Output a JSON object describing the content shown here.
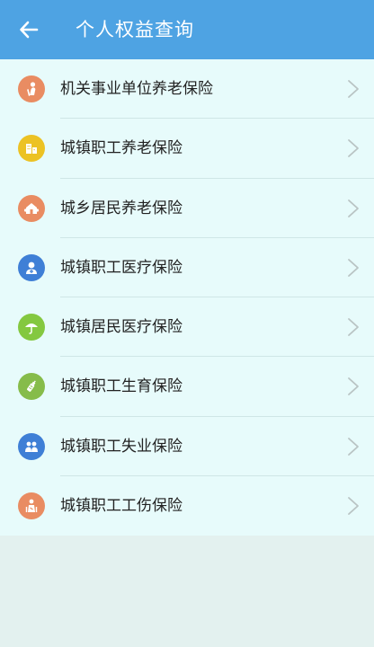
{
  "header": {
    "title": "个人权益查询",
    "back_icon": "arrow-left-icon",
    "background_color": "#4ea3e3"
  },
  "menu": {
    "items": [
      {
        "label": "机关事业单位养老保险",
        "icon": "elderly-person-icon",
        "icon_color": "#e98c62"
      },
      {
        "label": "城镇职工养老保险",
        "icon": "city-buildings-icon",
        "icon_color": "#ecc224"
      },
      {
        "label": "城乡居民养老保险",
        "icon": "house-trees-icon",
        "icon_color": "#e98c62"
      },
      {
        "label": "城镇职工医疗保险",
        "icon": "doctor-icon",
        "icon_color": "#3f7fd6"
      },
      {
        "label": "城镇居民医疗保险",
        "icon": "umbrella-icon",
        "icon_color": "#84c840"
      },
      {
        "label": "城镇职工生育保险",
        "icon": "baby-bottle-icon",
        "icon_color": "#86bc4a"
      },
      {
        "label": "城镇职工失业保险",
        "icon": "people-icon",
        "icon_color": "#3f7fd6"
      },
      {
        "label": "城镇职工工伤保险",
        "icon": "injured-worker-icon",
        "icon_color": "#e98c62"
      }
    ],
    "chevron_icon": "chevron-right-icon"
  }
}
